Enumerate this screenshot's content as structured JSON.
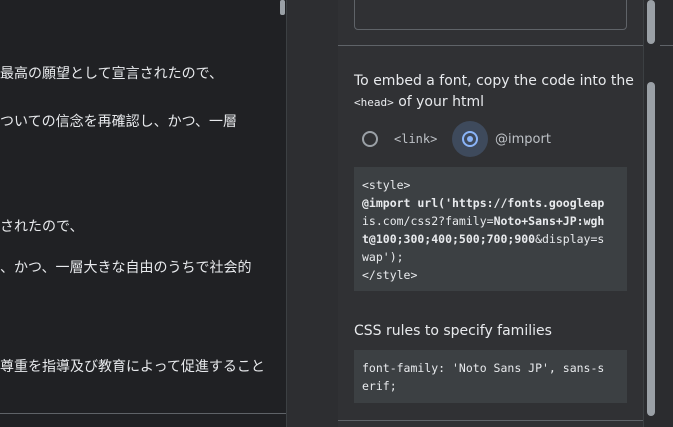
{
  "left_text": {
    "line1": "最高の願望として宣言されたので、",
    "line2": "ついての信念を再確認し、かつ、一層",
    "line3": "されたので、",
    "line4": "、かつ、一層大きな自由のうちで社会的",
    "line5": "尊重を指導及び教育によって促進すること"
  },
  "embed": {
    "intro": "To embed a font, copy the code into the",
    "head_tag": "<head>",
    "intro_suffix": "of your html"
  },
  "options": {
    "link_label": "<link>",
    "import_label": "@import",
    "selected": "@import"
  },
  "code": {
    "line1": "<style>",
    "line2_a": "@import url('https://fonts.googleap",
    "line3_a": "is.com/css2?family=",
    "line3_b": "Noto+Sans+JP:wgh",
    "line4_a": "t@100;300;400;500;700;900",
    "line4_b": "&display=s",
    "line5": "wap');",
    "line6": "</style>"
  },
  "css_rules": {
    "title": "CSS rules to specify families",
    "line1": "font-family: 'Noto Sans JP', sans-s",
    "line2": "erif;"
  },
  "icons": {
    "radio_unselected": "radio-unchecked-icon",
    "radio_selected": "radio-checked-icon"
  },
  "colors": {
    "accent": "#8ab4f8",
    "panel_bg": "#303134",
    "code_bg": "#3c4043",
    "page_bg": "#202124"
  }
}
